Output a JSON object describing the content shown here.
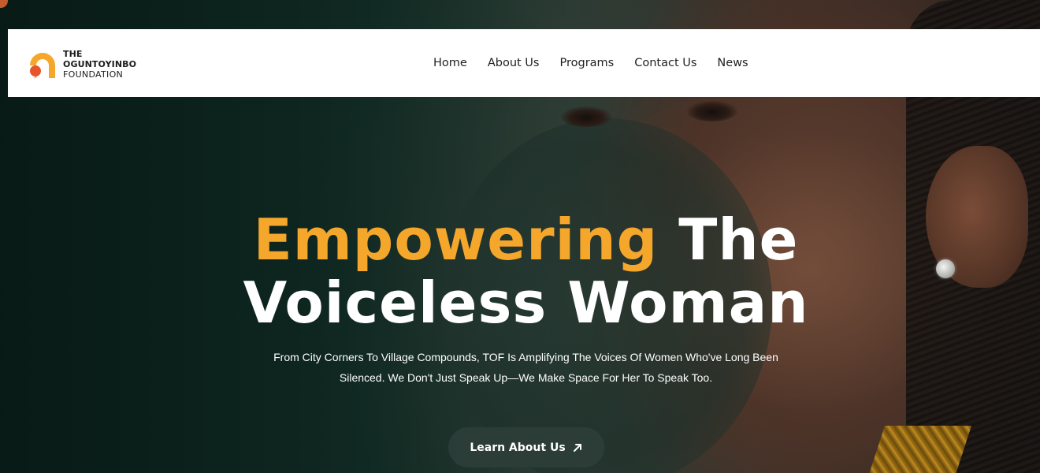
{
  "brand": {
    "line1": "THE",
    "line2": "OGUNTOYINBO",
    "line3": "FOUNDATION",
    "logo_icon": "foundation-logo-icon",
    "accent_color": "#f5a72c",
    "logo_dot_color": "#e8542c"
  },
  "nav": {
    "items": [
      {
        "label": "Home"
      },
      {
        "label": "About Us"
      },
      {
        "label": "Programs"
      },
      {
        "label": "Contact Us"
      },
      {
        "label": "News"
      }
    ]
  },
  "hero": {
    "headline_accent": "Empowering",
    "headline_rest_line1": "The",
    "headline_line2": "Voiceless Woman",
    "subtext_line1": "From City Corners To Village Compounds, TOF Is Amplifying The Voices Of Women Who've Long Been",
    "subtext_line2": "Silenced. We Don't Just Speak Up—We Make Space For Her To Speak Too.",
    "cta_label": "Learn About Us",
    "cta_icon": "arrow-up-right-icon"
  }
}
